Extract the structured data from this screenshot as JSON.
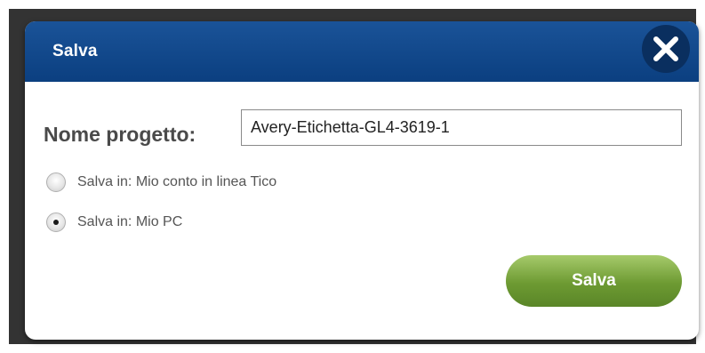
{
  "dialog": {
    "title": "Salva",
    "close_icon": "close-icon"
  },
  "form": {
    "name_label": "Nome progetto:",
    "name_value": "Avery-Etichetta-GL4-3619-1"
  },
  "options": [
    {
      "label": "Salva in: Mio conto in linea Tico",
      "selected": false
    },
    {
      "label": "Salva in: Mio PC",
      "selected": true
    }
  ],
  "actions": {
    "save_label": "Salva"
  },
  "colors": {
    "titlebar": "#0b3f80",
    "close_button": "#0a2f5f",
    "save_button": "#6d9a32",
    "backdrop": "#333333"
  }
}
